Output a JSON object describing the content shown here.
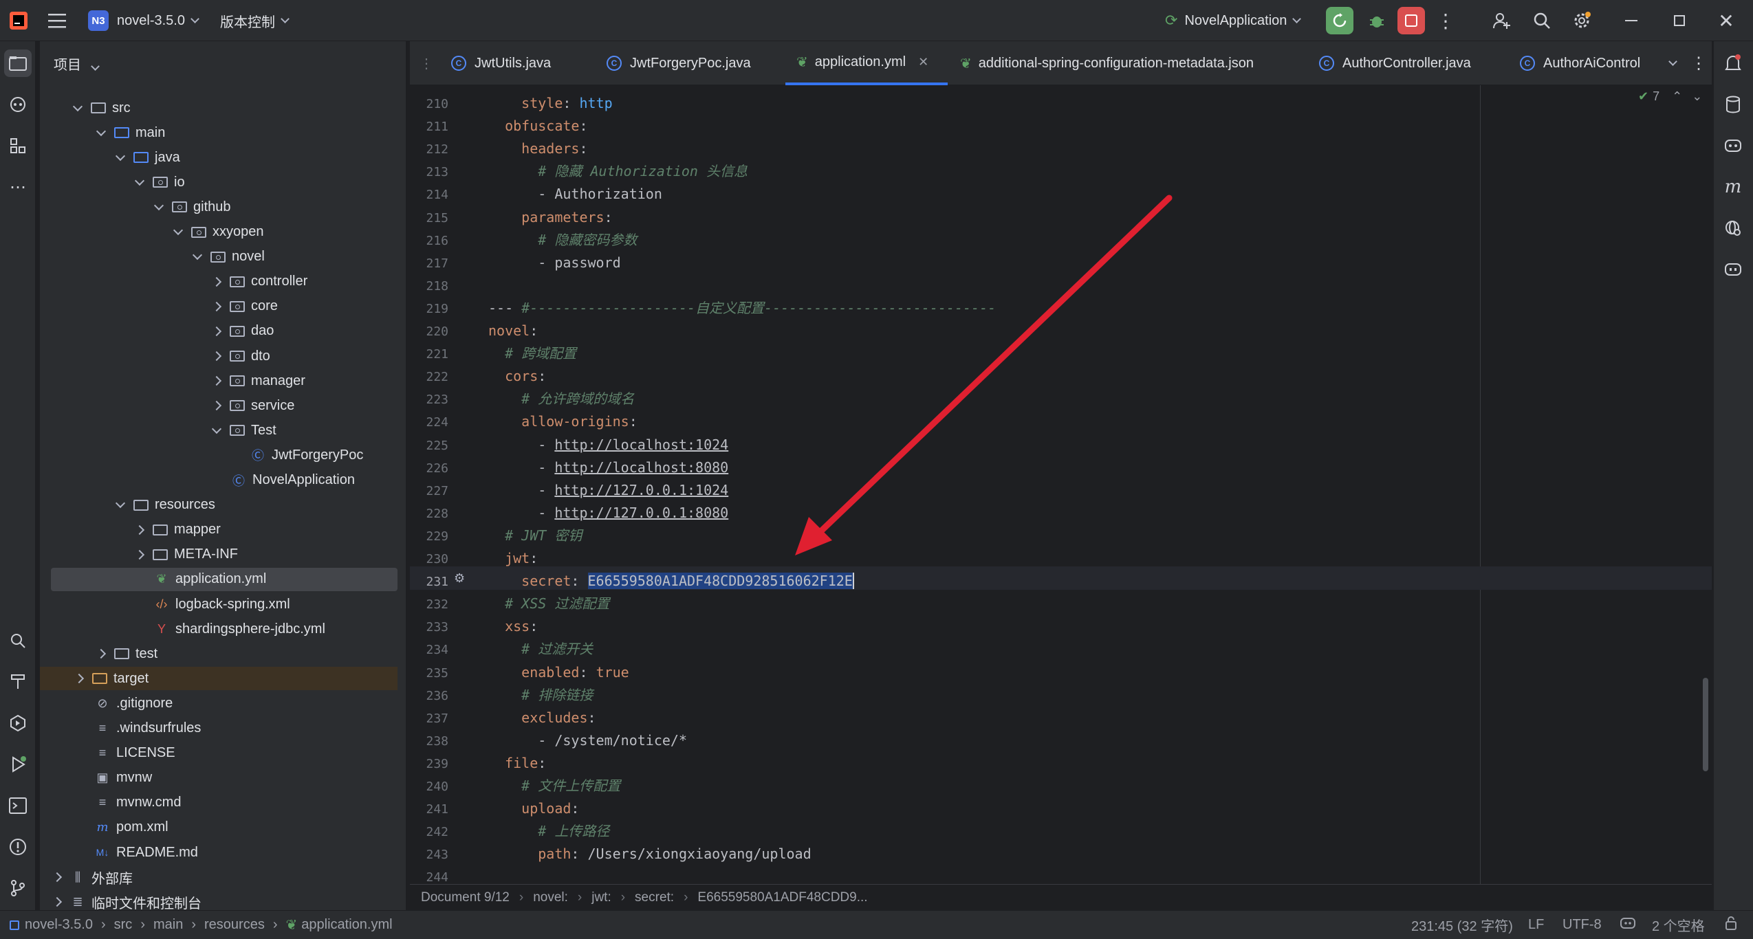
{
  "titlebar": {
    "project_badge": "N3",
    "project_name": "novel-3.5.0",
    "vcs": "版本控制",
    "run_config": "NovelApplication"
  },
  "project_panel": {
    "title": "项目",
    "tree": [
      {
        "label": "src"
      },
      {
        "label": "main"
      },
      {
        "label": "java"
      },
      {
        "label": "io"
      },
      {
        "label": "github"
      },
      {
        "label": "xxyopen"
      },
      {
        "label": "novel"
      },
      {
        "label": "controller"
      },
      {
        "label": "core"
      },
      {
        "label": "dao"
      },
      {
        "label": "dto"
      },
      {
        "label": "manager"
      },
      {
        "label": "service"
      },
      {
        "label": "Test"
      },
      {
        "label": "JwtForgeryPoc"
      },
      {
        "label": "NovelApplication"
      },
      {
        "label": "resources"
      },
      {
        "label": "mapper"
      },
      {
        "label": "META-INF"
      },
      {
        "label": "application.yml"
      },
      {
        "label": "logback-spring.xml"
      },
      {
        "label": "shardingsphere-jdbc.yml"
      },
      {
        "label": "test"
      },
      {
        "label": "target"
      },
      {
        "label": ".gitignore"
      },
      {
        "label": ".windsurfrules"
      },
      {
        "label": "LICENSE"
      },
      {
        "label": "mvnw"
      },
      {
        "label": "mvnw.cmd"
      },
      {
        "label": "pom.xml"
      },
      {
        "label": "README.md"
      },
      {
        "label": "外部库"
      },
      {
        "label": "临时文件和控制台"
      }
    ]
  },
  "tabs": [
    {
      "label": "JwtUtils.java"
    },
    {
      "label": "JwtForgeryPoc.java"
    },
    {
      "label": "application.yml"
    },
    {
      "label": "additional-spring-configuration-metadata.json"
    },
    {
      "label": "AuthorController.java"
    },
    {
      "label": "AuthorAiControl"
    }
  ],
  "inspection_count": "7",
  "lines": [
    {
      "n": "210",
      "p1": "    ",
      "key": "style",
      "sep": ": ",
      "val": "http"
    },
    {
      "n": "211",
      "p1": "  ",
      "key": "obfuscate",
      "sep": ":",
      "val": ""
    },
    {
      "n": "212",
      "p1": "    ",
      "key": "headers",
      "sep": ":",
      "val": ""
    },
    {
      "n": "213",
      "comment": "      # 隐藏 Authorization 头信息"
    },
    {
      "n": "214",
      "p1": "      - ",
      "key": "",
      "sep": "",
      "val": "Authorization"
    },
    {
      "n": "215",
      "p1": "    ",
      "key": "parameters",
      "sep": ":",
      "val": ""
    },
    {
      "n": "216",
      "comment": "      # 隐藏密码参数"
    },
    {
      "n": "217",
      "p1": "      - ",
      "key": "",
      "sep": "",
      "val": "password"
    },
    {
      "n": "218"
    },
    {
      "n": "219",
      "doc": "--- ",
      "comment_tail": "#--------------------自定义配置----------------------------"
    },
    {
      "n": "220",
      "p1": "",
      "key": "novel",
      "sep": ":",
      "val": ""
    },
    {
      "n": "221",
      "comment": "  # 跨域配置"
    },
    {
      "n": "222",
      "p1": "  ",
      "key": "cors",
      "sep": ":",
      "val": ""
    },
    {
      "n": "223",
      "comment": "    # 允许跨域的域名"
    },
    {
      "n": "224",
      "p1": "    ",
      "key": "allow-origins",
      "sep": ":",
      "val": ""
    },
    {
      "n": "225",
      "p1": "      - ",
      "url": "http://localhost:1024"
    },
    {
      "n": "226",
      "p1": "      - ",
      "url": "http://localhost:8080"
    },
    {
      "n": "227",
      "p1": "      - ",
      "url": "http://127.0.0.1:1024"
    },
    {
      "n": "228",
      "p1": "      - ",
      "url": "http://127.0.0.1:8080"
    },
    {
      "n": "229",
      "comment": "  # JWT 密钥"
    },
    {
      "n": "230",
      "p1": "  ",
      "key": "jwt",
      "sep": ":",
      "val": ""
    },
    {
      "n": "231",
      "p1": "    ",
      "key": "secret",
      "sep": ": ",
      "selected": "E66559580A1ADF48CDD928516062F12E"
    },
    {
      "n": "232",
      "comment": "  # XSS 过滤配置"
    },
    {
      "n": "233",
      "p1": "  ",
      "key": "xss",
      "sep": ":",
      "val": ""
    },
    {
      "n": "234",
      "comment": "    # 过滤开关"
    },
    {
      "n": "235",
      "p1": "    ",
      "key": "enabled",
      "sep": ": ",
      "kw": "true"
    },
    {
      "n": "236",
      "comment": "    # 排除链接"
    },
    {
      "n": "237",
      "p1": "    ",
      "key": "excludes",
      "sep": ":",
      "val": ""
    },
    {
      "n": "238",
      "p1": "      - ",
      "key": "",
      "sep": "",
      "val": "/system/notice/*"
    },
    {
      "n": "239",
      "p1": "  ",
      "key": "file",
      "sep": ":",
      "val": ""
    },
    {
      "n": "240",
      "comment": "    # 文件上传配置"
    },
    {
      "n": "241",
      "p1": "    ",
      "key": "upload",
      "sep": ":",
      "val": ""
    },
    {
      "n": "242",
      "comment": "      # 上传路径"
    },
    {
      "n": "243",
      "p1": "      ",
      "key": "path",
      "sep": ": ",
      "val": "/Users/xiongxiaoyang/upload"
    },
    {
      "n": "244"
    }
  ],
  "breadcrumb_editor": [
    "Document 9/12",
    "novel:",
    "jwt:",
    "secret:",
    "E66559580A1ADF48CDD9..."
  ],
  "statusbar": {
    "path": [
      "novel-3.5.0",
      "src",
      "main",
      "resources",
      "application.yml"
    ],
    "position": "231:45 (32 字符)",
    "line_sep": "LF",
    "encoding": "UTF-8",
    "indent": "2 个空格"
  },
  "colors": {
    "accent": "#3574f0",
    "arrow": "#e02030",
    "stop": "#d94f4f",
    "run": "#5fa366"
  }
}
